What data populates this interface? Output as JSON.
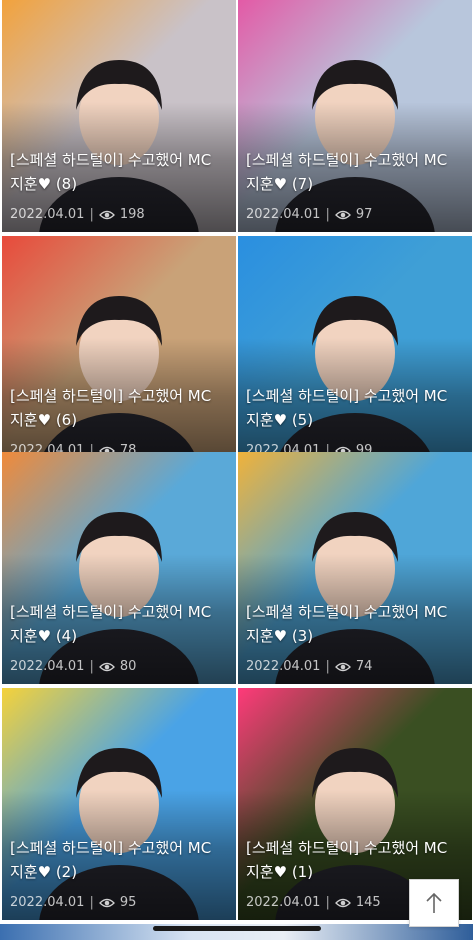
{
  "posts": [
    {
      "title_line1": "[스페셜 하드털이] 수고했어 MC",
      "title_line2": "지훈♥ (8)",
      "date": "2022.04.01",
      "views": "198",
      "bg": "#c9c2c8",
      "accent": "#f2a23c"
    },
    {
      "title_line1": "[스페셜 하드털이] 수고했어 MC",
      "title_line2": "지훈♥ (7)",
      "date": "2022.04.01",
      "views": "97",
      "bg": "#b8c6dc",
      "accent": "#e35aa6"
    },
    {
      "title_line1": "[스페셜 하드털이] 수고했어 MC",
      "title_line2": "지훈♥ (6)",
      "date": "2022.04.01",
      "views": "78",
      "bg": "#c9a278",
      "accent": "#e84a3b"
    },
    {
      "title_line1": "[스페셜 하드털이] 수고했어 MC",
      "title_line2": "지훈♥ (5)",
      "date": "2022.04.01",
      "views": "99",
      "bg": "#3f9fd6",
      "accent": "#2a8fe0"
    },
    {
      "title_line1": "[스페셜 하드털이] 수고했어 MC",
      "title_line2": "지훈♥ (4)",
      "date": "2022.04.01",
      "views": "80",
      "bg": "#5aa9d8",
      "accent": "#f08a3a"
    },
    {
      "title_line1": "[스페셜 하드털이] 수고했어 MC",
      "title_line2": "지훈♥ (3)",
      "date": "2022.04.01",
      "views": "74",
      "bg": "#4fa6d8",
      "accent": "#f0b23a"
    },
    {
      "title_line1": "[스페셜 하드털이] 수고했어 MC",
      "title_line2": "지훈♥ (2)",
      "date": "2022.04.01",
      "views": "95",
      "bg": "#4aa3e6",
      "accent": "#f5d23a"
    },
    {
      "title_line1": "[스페셜 하드털이] 수고했어 MC",
      "title_line2": "지훈♥ (1)",
      "date": "2022.04.01",
      "views": "145",
      "bg": "#3a4f22",
      "accent": "#ff3a7a"
    }
  ],
  "scroll_top": {
    "icon": "arrow-up-icon"
  }
}
